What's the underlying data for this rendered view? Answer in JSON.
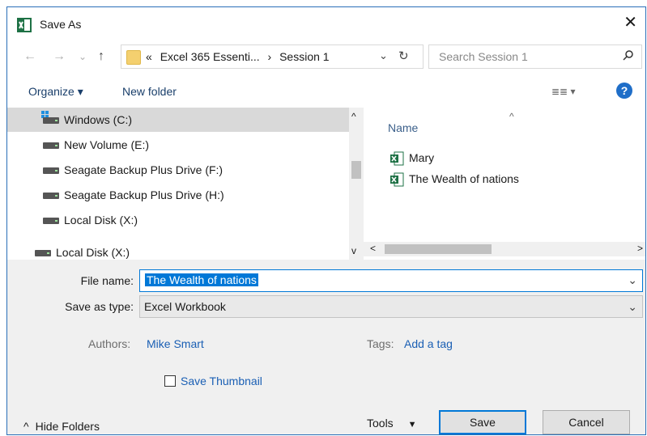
{
  "window": {
    "title": "Save As",
    "icon": "excel-app-icon"
  },
  "nav": {
    "back_icon": "←",
    "forward_icon": "→",
    "recent_icon": "⌄",
    "up_icon": "↑",
    "crumbs": [
      "«",
      "Excel 365 Essenti...",
      "›",
      "Session 1"
    ],
    "dropdown_icon": "⌄",
    "refresh_icon": "↻",
    "search_placeholder": "Search Session 1",
    "search_icon": "⚲"
  },
  "toolbar": {
    "organize": "Organize ▾",
    "new_folder": "New folder",
    "view": "≣≣ ▾",
    "help": "?"
  },
  "tree": [
    {
      "label": "Windows (C:)",
      "type": "windows"
    },
    {
      "label": "New Volume (E:)",
      "type": "drive"
    },
    {
      "label": "Seagate Backup Plus Drive (F:)",
      "type": "drive"
    },
    {
      "label": "Seagate Backup Plus Drive (H:)",
      "type": "drive"
    },
    {
      "label": "Local Disk (X:)",
      "type": "drive"
    },
    {
      "label": "Local Disk (X:)",
      "type": "drive"
    }
  ],
  "files": {
    "column_name": "Name",
    "sort_indicator": "^",
    "items": [
      "Mary",
      "The Wealth of nations"
    ]
  },
  "form": {
    "file_name_label": "File name:",
    "file_name_value": "The Wealth of nations",
    "save_as_type_label": "Save as type:",
    "save_as_type_value": "Excel Workbook",
    "authors_label": "Authors:",
    "authors_value": "Mike Smart",
    "tags_label": "Tags:",
    "tags_value": "Add a tag",
    "save_thumbnail": "Save Thumbnail"
  },
  "footer": {
    "hide_folders": "Hide Folders",
    "hide_icon": "^",
    "tools": "Tools",
    "tools_icon": "▼",
    "save": "Save",
    "cancel": "Cancel"
  },
  "colors": {
    "accent": "#0078d7",
    "link": "#1a5fb4",
    "excel": "#1e7145"
  }
}
